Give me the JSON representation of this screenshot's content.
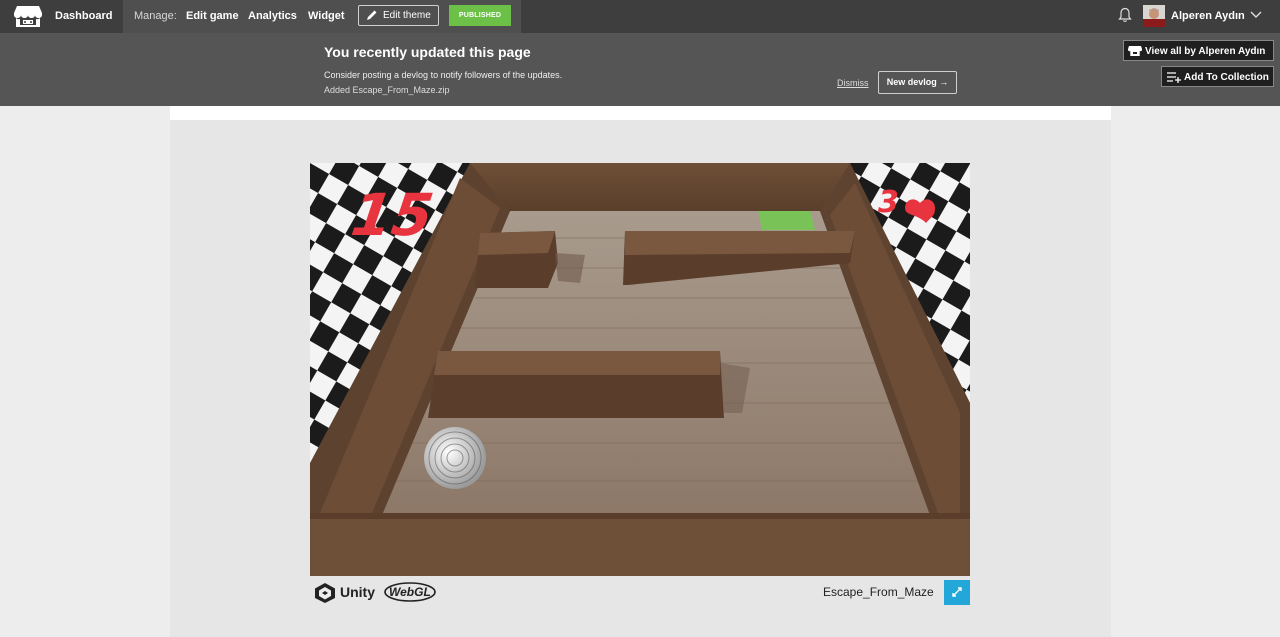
{
  "topbar": {
    "dashboard": "Dashboard",
    "manage_label": "Manage:",
    "nav": [
      {
        "label": "Edit game"
      },
      {
        "label": "Analytics"
      },
      {
        "label": "Widget"
      }
    ],
    "edit_theme": "Edit theme",
    "status": "PUBLISHED",
    "user_name": "Alperen Aydın"
  },
  "banner": {
    "title": "You recently updated this page",
    "text": "Consider posting a devlog to notify followers of the updates.",
    "file": "Added Escape_From_Maze.zip",
    "dismiss": "Dismiss",
    "new_devlog": "New devlog →"
  },
  "side": {
    "view_all": "View all by Alperen Aydın",
    "add_collection": "Add To Collection"
  },
  "game": {
    "score": "15",
    "lives": "3",
    "engine": "Unity",
    "platform": "WebGL",
    "title": "Escape_From_Maze"
  },
  "colors": {
    "published": "#6cc048",
    "fullscreen": "#23a7d8",
    "hud": "#e8343f"
  }
}
